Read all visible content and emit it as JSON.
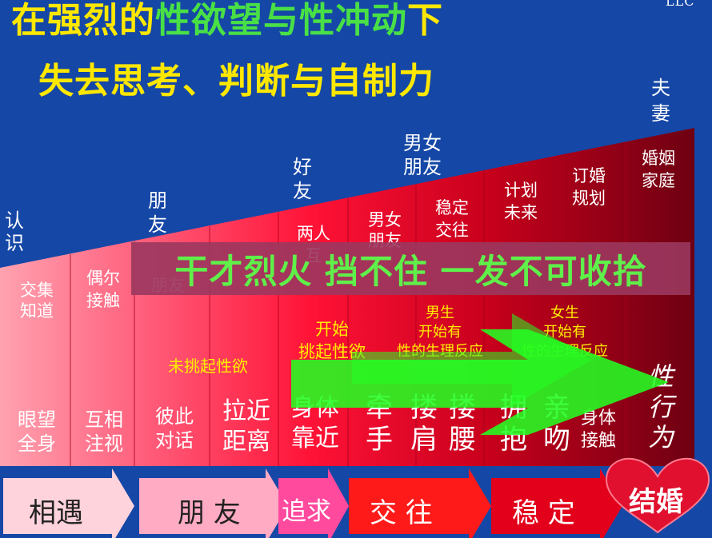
{
  "title": {
    "line1_a": "在强烈的",
    "line1_b": "性欲望与性冲动",
    "line1_c": "下",
    "line2": "失去思考、判断与自制力"
  },
  "corner_mark": "LLC",
  "stages_top": [
    {
      "name": "认识",
      "lines": [
        "认",
        "识"
      ]
    },
    {
      "name": "朋友",
      "lines": [
        "朋",
        "友"
      ]
    },
    {
      "name": "好友",
      "lines": [
        "好",
        "友"
      ]
    },
    {
      "name": "男女朋友",
      "lines": [
        "男女",
        "朋友"
      ]
    },
    {
      "name": "夫妻",
      "lines": [
        "夫",
        "妻"
      ]
    }
  ],
  "relations": [
    {
      "lines": [
        "交集",
        "知道"
      ]
    },
    {
      "lines": [
        "偶尔",
        "接触"
      ]
    },
    {
      "lines": [
        "朋友"
      ]
    },
    {
      "lines": [
        "两人",
        "互"
      ]
    },
    {
      "lines": [
        "男女",
        "朋友"
      ]
    },
    {
      "lines": [
        "稳定",
        "交往"
      ]
    },
    {
      "lines": [
        "计划",
        "未来"
      ]
    },
    {
      "lines": [
        "订婚",
        "规划"
      ]
    },
    {
      "lines": [
        "婚姻",
        "家庭"
      ]
    }
  ],
  "desire": {
    "d1": "未挑起性欲",
    "d2": [
      "开始",
      "挑起性欲"
    ],
    "d3": [
      "男生",
      "开始有",
      "性的生理反应"
    ],
    "d4": [
      "女生",
      "开始有",
      "性的生理反应"
    ]
  },
  "actions": [
    {
      "lines": [
        "眼望",
        "全身"
      ]
    },
    {
      "lines": [
        "互相",
        "注视"
      ]
    },
    {
      "lines": [
        "彼此",
        "对话"
      ]
    },
    {
      "lines": [
        "拉近",
        "距离"
      ]
    },
    {
      "lines": [
        "身体",
        "靠近"
      ]
    },
    {
      "lines": [
        "牵",
        "手"
      ]
    },
    {
      "lines": [
        "搂",
        "肩"
      ]
    },
    {
      "lines": [
        "搂",
        "腰"
      ]
    },
    {
      "lines": [
        "拥",
        "抱"
      ]
    },
    {
      "lines": [
        "亲",
        "吻"
      ]
    },
    {
      "lines": [
        "身体",
        "接触"
      ]
    },
    {
      "lines": [
        "性",
        "行",
        "为"
      ]
    }
  ],
  "banner": "干才烈火 挡不住 一发不可收拾",
  "bottom": {
    "s1": "相遇",
    "s2": "朋  友",
    "s3": "追求",
    "s4": "交  往",
    "s5": "稳  定",
    "s6": "结婚"
  },
  "colors": {
    "background": "#1547a6",
    "title_yellow": "#ffe800",
    "title_green": "#49e046",
    "banner_text": "#5ff04a",
    "arrow_green": "#22ff22"
  }
}
